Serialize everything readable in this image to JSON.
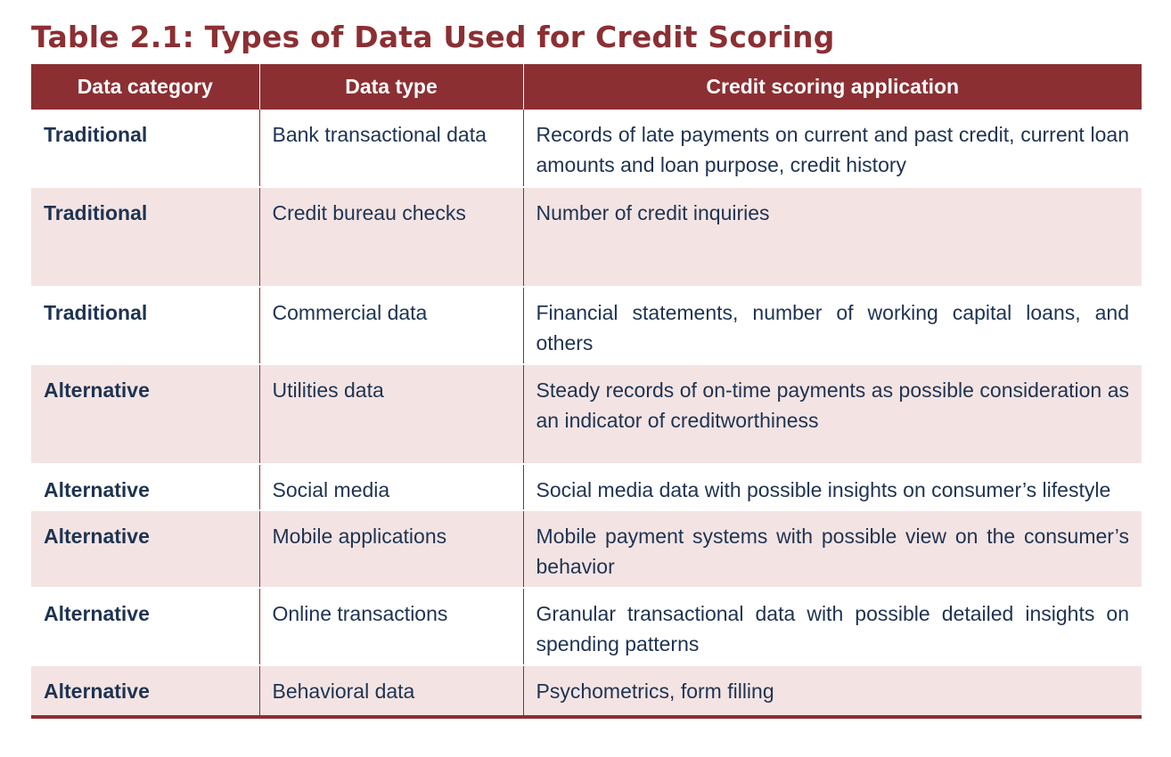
{
  "title": "Table 2.1: Types of Data Used for Credit Scoring",
  "columns": [
    "Data category",
    "Data type",
    "Credit scoring application"
  ],
  "rows": [
    {
      "category": "Traditional",
      "type": "Bank transactional data",
      "application": "Records of late payments on current and past credit, current loan amounts and loan purpose, credit history"
    },
    {
      "category": "Traditional",
      "type": "Credit bureau checks",
      "application": "Number of credit inquiries"
    },
    {
      "category": "Traditional",
      "type": "Commercial data",
      "application": "Financial statements, number of working capital loans, and others"
    },
    {
      "category": "Alternative",
      "type": "Utilities data",
      "application": "Steady records of on-time payments as possible consideration as an indicator of creditworthiness"
    },
    {
      "category": "Alternative",
      "type": "Social media",
      "application": "Social media data with possible insights on consumer’s lifestyle"
    },
    {
      "category": "Alternative",
      "type": "Mobile applications",
      "application": "Mobile payment systems with possible view on the consumer’s behavior"
    },
    {
      "category": "Alternative",
      "type": "Online transactions",
      "application": "Granular transactional data with possible detailed insights on spending patterns"
    },
    {
      "category": "Alternative",
      "type": "Behavioral data",
      "application": "Psychometrics, form filling"
    }
  ],
  "colors": {
    "accent": "#8b2f33",
    "band": "#f3e4e3",
    "text": "#1f3352"
  }
}
